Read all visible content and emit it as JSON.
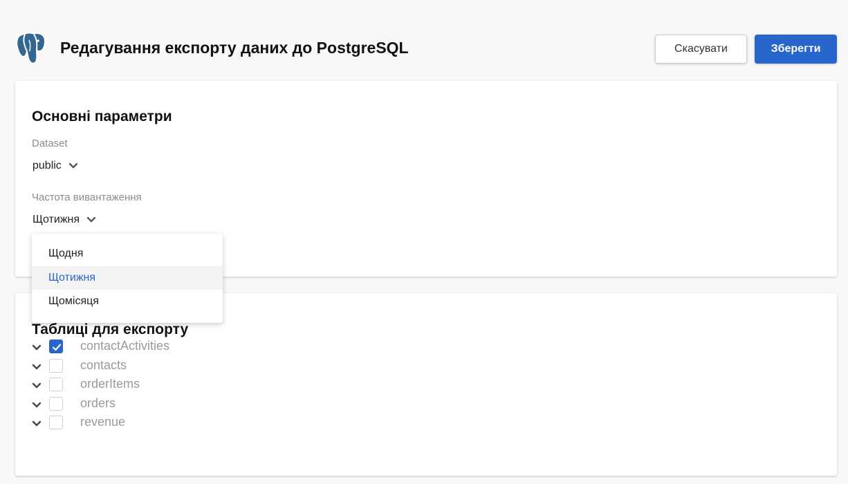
{
  "header": {
    "logo_icon": "postgresql-elephant-icon",
    "title": "Редагування експорту даних до PostgreSQL",
    "cancel_label": "Скасувати",
    "save_label": "Зберегти"
  },
  "main": {
    "section_title": "Основні параметри",
    "dataset": {
      "label": "Dataset",
      "value": "public"
    },
    "frequency": {
      "label": "Частота вивантаження",
      "value": "Щотижня",
      "options": [
        "Щодня",
        "Щотижня",
        "Щомісяця"
      ],
      "selected_index": 1
    }
  },
  "tables": {
    "section_title": "Таблиці для експорту",
    "rows": [
      {
        "name": "contactActivities",
        "checked": true
      },
      {
        "name": "contacts",
        "checked": false
      },
      {
        "name": "orderItems",
        "checked": false
      },
      {
        "name": "orders",
        "checked": false
      },
      {
        "name": "revenue",
        "checked": false
      }
    ]
  },
  "colors": {
    "accent": "#2866cc",
    "background": "#f8f8f8",
    "muted_text": "#9a9a9a"
  }
}
